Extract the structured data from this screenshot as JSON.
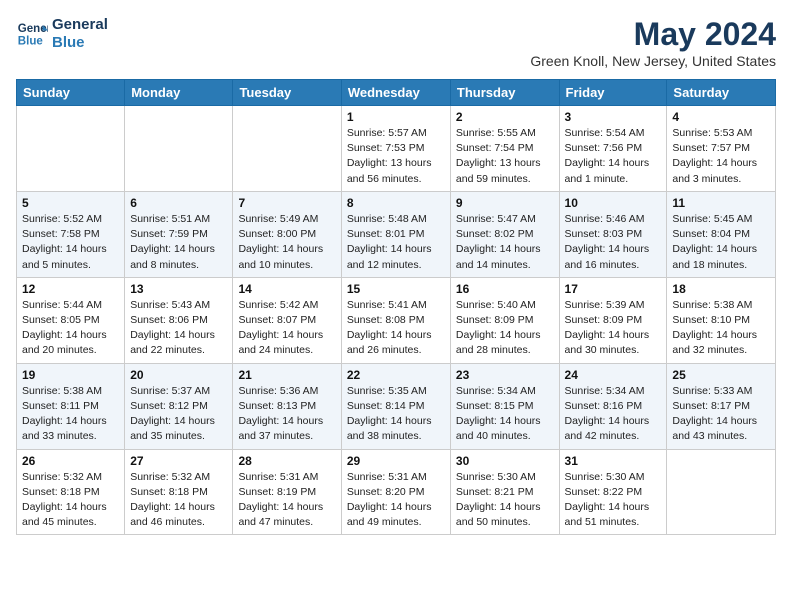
{
  "header": {
    "logo_line1": "General",
    "logo_line2": "Blue",
    "month_year": "May 2024",
    "location": "Green Knoll, New Jersey, United States"
  },
  "days_of_week": [
    "Sunday",
    "Monday",
    "Tuesday",
    "Wednesday",
    "Thursday",
    "Friday",
    "Saturday"
  ],
  "weeks": [
    [
      {
        "num": "",
        "info": ""
      },
      {
        "num": "",
        "info": ""
      },
      {
        "num": "",
        "info": ""
      },
      {
        "num": "1",
        "sunrise": "Sunrise: 5:57 AM",
        "sunset": "Sunset: 7:53 PM",
        "daylight": "Daylight: 13 hours and 56 minutes."
      },
      {
        "num": "2",
        "sunrise": "Sunrise: 5:55 AM",
        "sunset": "Sunset: 7:54 PM",
        "daylight": "Daylight: 13 hours and 59 minutes."
      },
      {
        "num": "3",
        "sunrise": "Sunrise: 5:54 AM",
        "sunset": "Sunset: 7:56 PM",
        "daylight": "Daylight: 14 hours and 1 minute."
      },
      {
        "num": "4",
        "sunrise": "Sunrise: 5:53 AM",
        "sunset": "Sunset: 7:57 PM",
        "daylight": "Daylight: 14 hours and 3 minutes."
      }
    ],
    [
      {
        "num": "5",
        "sunrise": "Sunrise: 5:52 AM",
        "sunset": "Sunset: 7:58 PM",
        "daylight": "Daylight: 14 hours and 5 minutes."
      },
      {
        "num": "6",
        "sunrise": "Sunrise: 5:51 AM",
        "sunset": "Sunset: 7:59 PM",
        "daylight": "Daylight: 14 hours and 8 minutes."
      },
      {
        "num": "7",
        "sunrise": "Sunrise: 5:49 AM",
        "sunset": "Sunset: 8:00 PM",
        "daylight": "Daylight: 14 hours and 10 minutes."
      },
      {
        "num": "8",
        "sunrise": "Sunrise: 5:48 AM",
        "sunset": "Sunset: 8:01 PM",
        "daylight": "Daylight: 14 hours and 12 minutes."
      },
      {
        "num": "9",
        "sunrise": "Sunrise: 5:47 AM",
        "sunset": "Sunset: 8:02 PM",
        "daylight": "Daylight: 14 hours and 14 minutes."
      },
      {
        "num": "10",
        "sunrise": "Sunrise: 5:46 AM",
        "sunset": "Sunset: 8:03 PM",
        "daylight": "Daylight: 14 hours and 16 minutes."
      },
      {
        "num": "11",
        "sunrise": "Sunrise: 5:45 AM",
        "sunset": "Sunset: 8:04 PM",
        "daylight": "Daylight: 14 hours and 18 minutes."
      }
    ],
    [
      {
        "num": "12",
        "sunrise": "Sunrise: 5:44 AM",
        "sunset": "Sunset: 8:05 PM",
        "daylight": "Daylight: 14 hours and 20 minutes."
      },
      {
        "num": "13",
        "sunrise": "Sunrise: 5:43 AM",
        "sunset": "Sunset: 8:06 PM",
        "daylight": "Daylight: 14 hours and 22 minutes."
      },
      {
        "num": "14",
        "sunrise": "Sunrise: 5:42 AM",
        "sunset": "Sunset: 8:07 PM",
        "daylight": "Daylight: 14 hours and 24 minutes."
      },
      {
        "num": "15",
        "sunrise": "Sunrise: 5:41 AM",
        "sunset": "Sunset: 8:08 PM",
        "daylight": "Daylight: 14 hours and 26 minutes."
      },
      {
        "num": "16",
        "sunrise": "Sunrise: 5:40 AM",
        "sunset": "Sunset: 8:09 PM",
        "daylight": "Daylight: 14 hours and 28 minutes."
      },
      {
        "num": "17",
        "sunrise": "Sunrise: 5:39 AM",
        "sunset": "Sunset: 8:09 PM",
        "daylight": "Daylight: 14 hours and 30 minutes."
      },
      {
        "num": "18",
        "sunrise": "Sunrise: 5:38 AM",
        "sunset": "Sunset: 8:10 PM",
        "daylight": "Daylight: 14 hours and 32 minutes."
      }
    ],
    [
      {
        "num": "19",
        "sunrise": "Sunrise: 5:38 AM",
        "sunset": "Sunset: 8:11 PM",
        "daylight": "Daylight: 14 hours and 33 minutes."
      },
      {
        "num": "20",
        "sunrise": "Sunrise: 5:37 AM",
        "sunset": "Sunset: 8:12 PM",
        "daylight": "Daylight: 14 hours and 35 minutes."
      },
      {
        "num": "21",
        "sunrise": "Sunrise: 5:36 AM",
        "sunset": "Sunset: 8:13 PM",
        "daylight": "Daylight: 14 hours and 37 minutes."
      },
      {
        "num": "22",
        "sunrise": "Sunrise: 5:35 AM",
        "sunset": "Sunset: 8:14 PM",
        "daylight": "Daylight: 14 hours and 38 minutes."
      },
      {
        "num": "23",
        "sunrise": "Sunrise: 5:34 AM",
        "sunset": "Sunset: 8:15 PM",
        "daylight": "Daylight: 14 hours and 40 minutes."
      },
      {
        "num": "24",
        "sunrise": "Sunrise: 5:34 AM",
        "sunset": "Sunset: 8:16 PM",
        "daylight": "Daylight: 14 hours and 42 minutes."
      },
      {
        "num": "25",
        "sunrise": "Sunrise: 5:33 AM",
        "sunset": "Sunset: 8:17 PM",
        "daylight": "Daylight: 14 hours and 43 minutes."
      }
    ],
    [
      {
        "num": "26",
        "sunrise": "Sunrise: 5:32 AM",
        "sunset": "Sunset: 8:18 PM",
        "daylight": "Daylight: 14 hours and 45 minutes."
      },
      {
        "num": "27",
        "sunrise": "Sunrise: 5:32 AM",
        "sunset": "Sunset: 8:18 PM",
        "daylight": "Daylight: 14 hours and 46 minutes."
      },
      {
        "num": "28",
        "sunrise": "Sunrise: 5:31 AM",
        "sunset": "Sunset: 8:19 PM",
        "daylight": "Daylight: 14 hours and 47 minutes."
      },
      {
        "num": "29",
        "sunrise": "Sunrise: 5:31 AM",
        "sunset": "Sunset: 8:20 PM",
        "daylight": "Daylight: 14 hours and 49 minutes."
      },
      {
        "num": "30",
        "sunrise": "Sunrise: 5:30 AM",
        "sunset": "Sunset: 8:21 PM",
        "daylight": "Daylight: 14 hours and 50 minutes."
      },
      {
        "num": "31",
        "sunrise": "Sunrise: 5:30 AM",
        "sunset": "Sunset: 8:22 PM",
        "daylight": "Daylight: 14 hours and 51 minutes."
      },
      {
        "num": "",
        "info": ""
      }
    ]
  ]
}
